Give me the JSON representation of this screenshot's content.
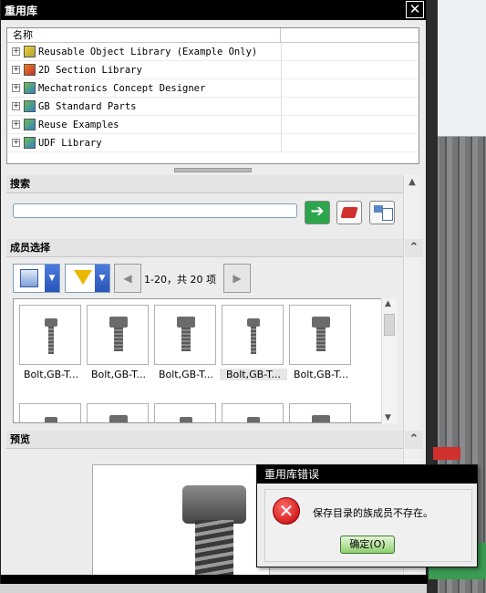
{
  "window": {
    "title": "重用库",
    "close_glyph": "✕"
  },
  "tree": {
    "column_header": "名称",
    "items": [
      {
        "label": "Reusable Object Library (Example Only)",
        "icon": "library-yellow-icon"
      },
      {
        "label": "2D Section Library",
        "icon": "library-orange-icon"
      },
      {
        "label": "Mechatronics Concept Designer",
        "icon": "library-icon"
      },
      {
        "label": "GB Standard Parts",
        "icon": "library-icon"
      },
      {
        "label": "Reuse Examples",
        "icon": "library-icon"
      },
      {
        "label": "UDF Library",
        "icon": "library-icon"
      }
    ]
  },
  "search": {
    "header": "搜索",
    "value": "",
    "go_glyph": "➔"
  },
  "members": {
    "header": "成员选择",
    "page_info": "1-20，共 20 项",
    "prev_glyph": "◀",
    "next_glyph": "▶",
    "items": [
      {
        "label": "Bolt,GB-T...",
        "selected": false
      },
      {
        "label": "Bolt,GB-T...",
        "selected": false
      },
      {
        "label": "Bolt,GB-T...",
        "selected": false
      },
      {
        "label": "Bolt,GB-T...",
        "selected": true
      },
      {
        "label": "Bolt,GB-T...",
        "selected": false
      }
    ]
  },
  "preview": {
    "header": "预览"
  },
  "error_dialog": {
    "title": "重用库错误",
    "icon_glyph": "✕",
    "message": "保存目录的族成员不存在。",
    "ok_label": "确定(O)"
  },
  "colors": {
    "title_bg": "#000000",
    "accent_green": "#2ba64a",
    "error_red": "#c20000"
  }
}
